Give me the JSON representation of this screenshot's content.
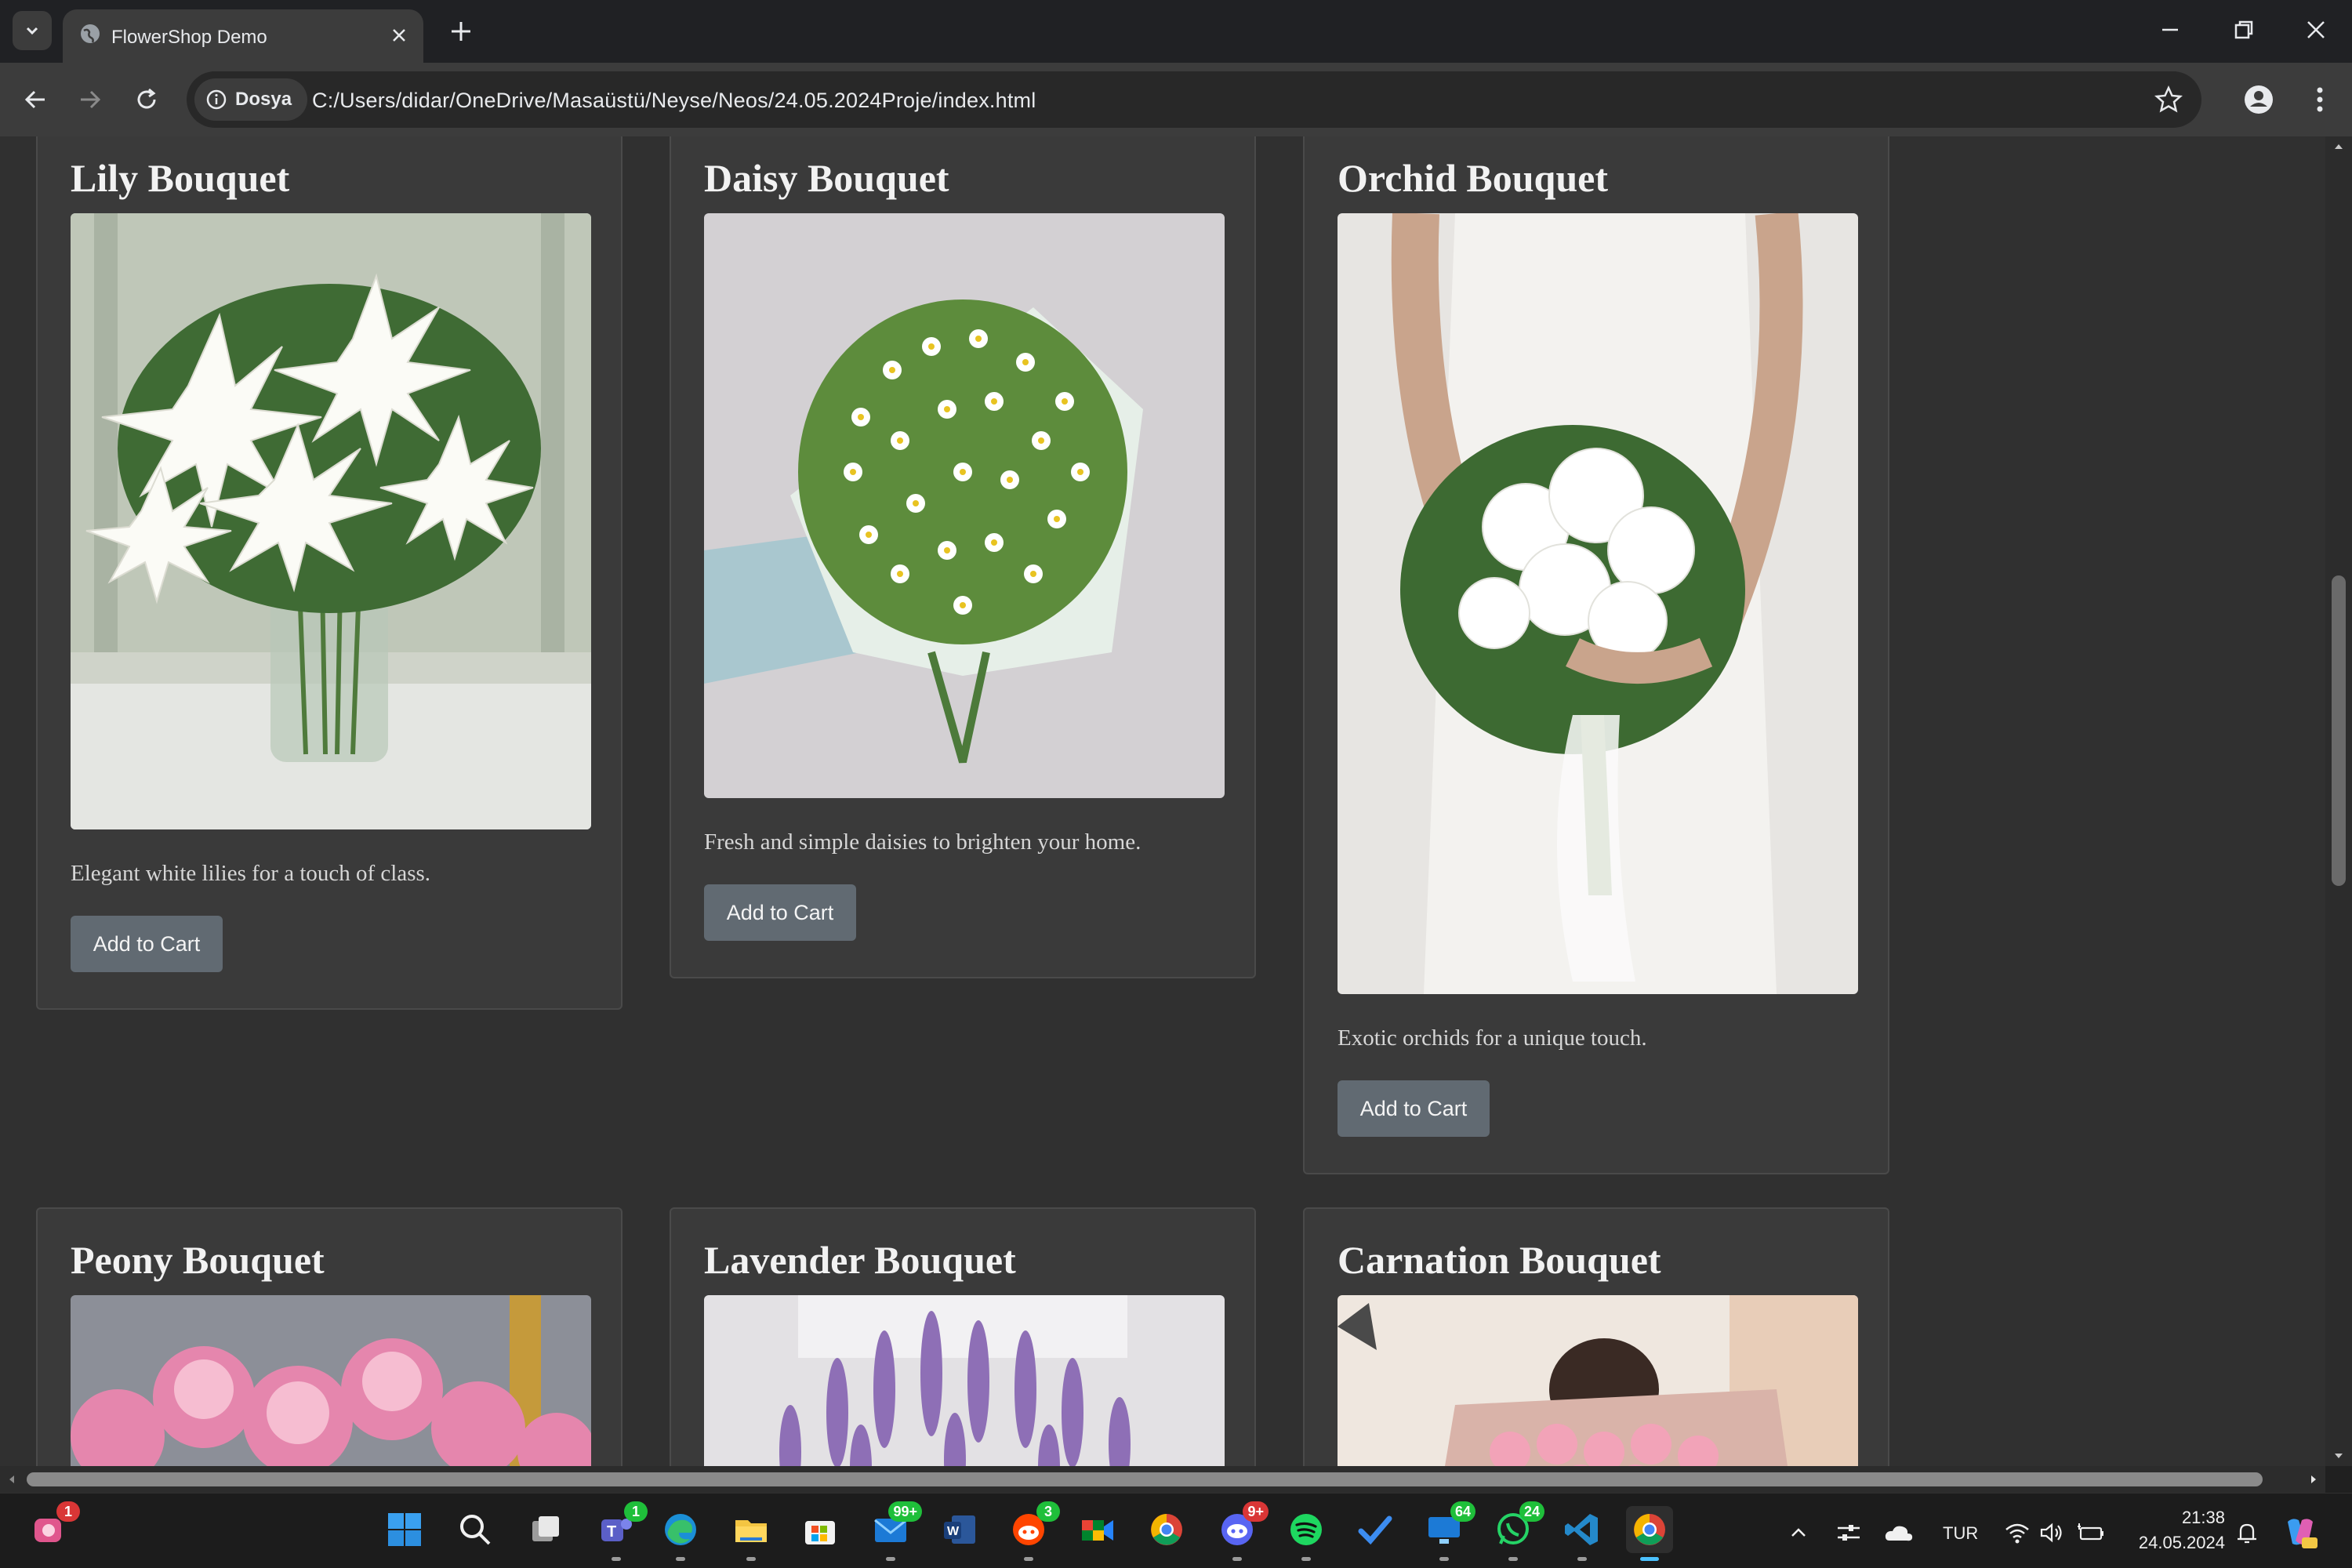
{
  "browser": {
    "tab_title": "FlowerShop Demo",
    "site_info_label": "Dosya",
    "url": "C:/Users/didar/OneDrive/Masaüstü/Neyse/Neos/24.05.2024Proje/index.html"
  },
  "products": [
    {
      "title": "Lily Bouquet",
      "description": "Elegant white lilies for a touch of class.",
      "button": "Add to Cart"
    },
    {
      "title": "Daisy Bouquet",
      "description": "Fresh and simple daisies to brighten your home.",
      "button": "Add to Cart"
    },
    {
      "title": "Orchid Bouquet",
      "description": "Exotic orchids for a unique touch.",
      "button": "Add to Cart"
    },
    {
      "title": "Peony Bouquet"
    },
    {
      "title": "Lavender Bouquet"
    },
    {
      "title": "Carnation Bouquet"
    }
  ],
  "taskbar": {
    "badges": {
      "widgets": "1",
      "teams": "1",
      "mail": "99+",
      "reddit": "3",
      "discord": "9+",
      "todo_app": "64",
      "whatsapp": "24"
    },
    "language": "TUR",
    "time": "21:38",
    "date": "24.05.2024"
  },
  "colors": {
    "page_bg": "#303030",
    "card_bg": "#3a3a3a",
    "button_bg": "#616a72",
    "chrome_bg": "#3c3c3c"
  }
}
